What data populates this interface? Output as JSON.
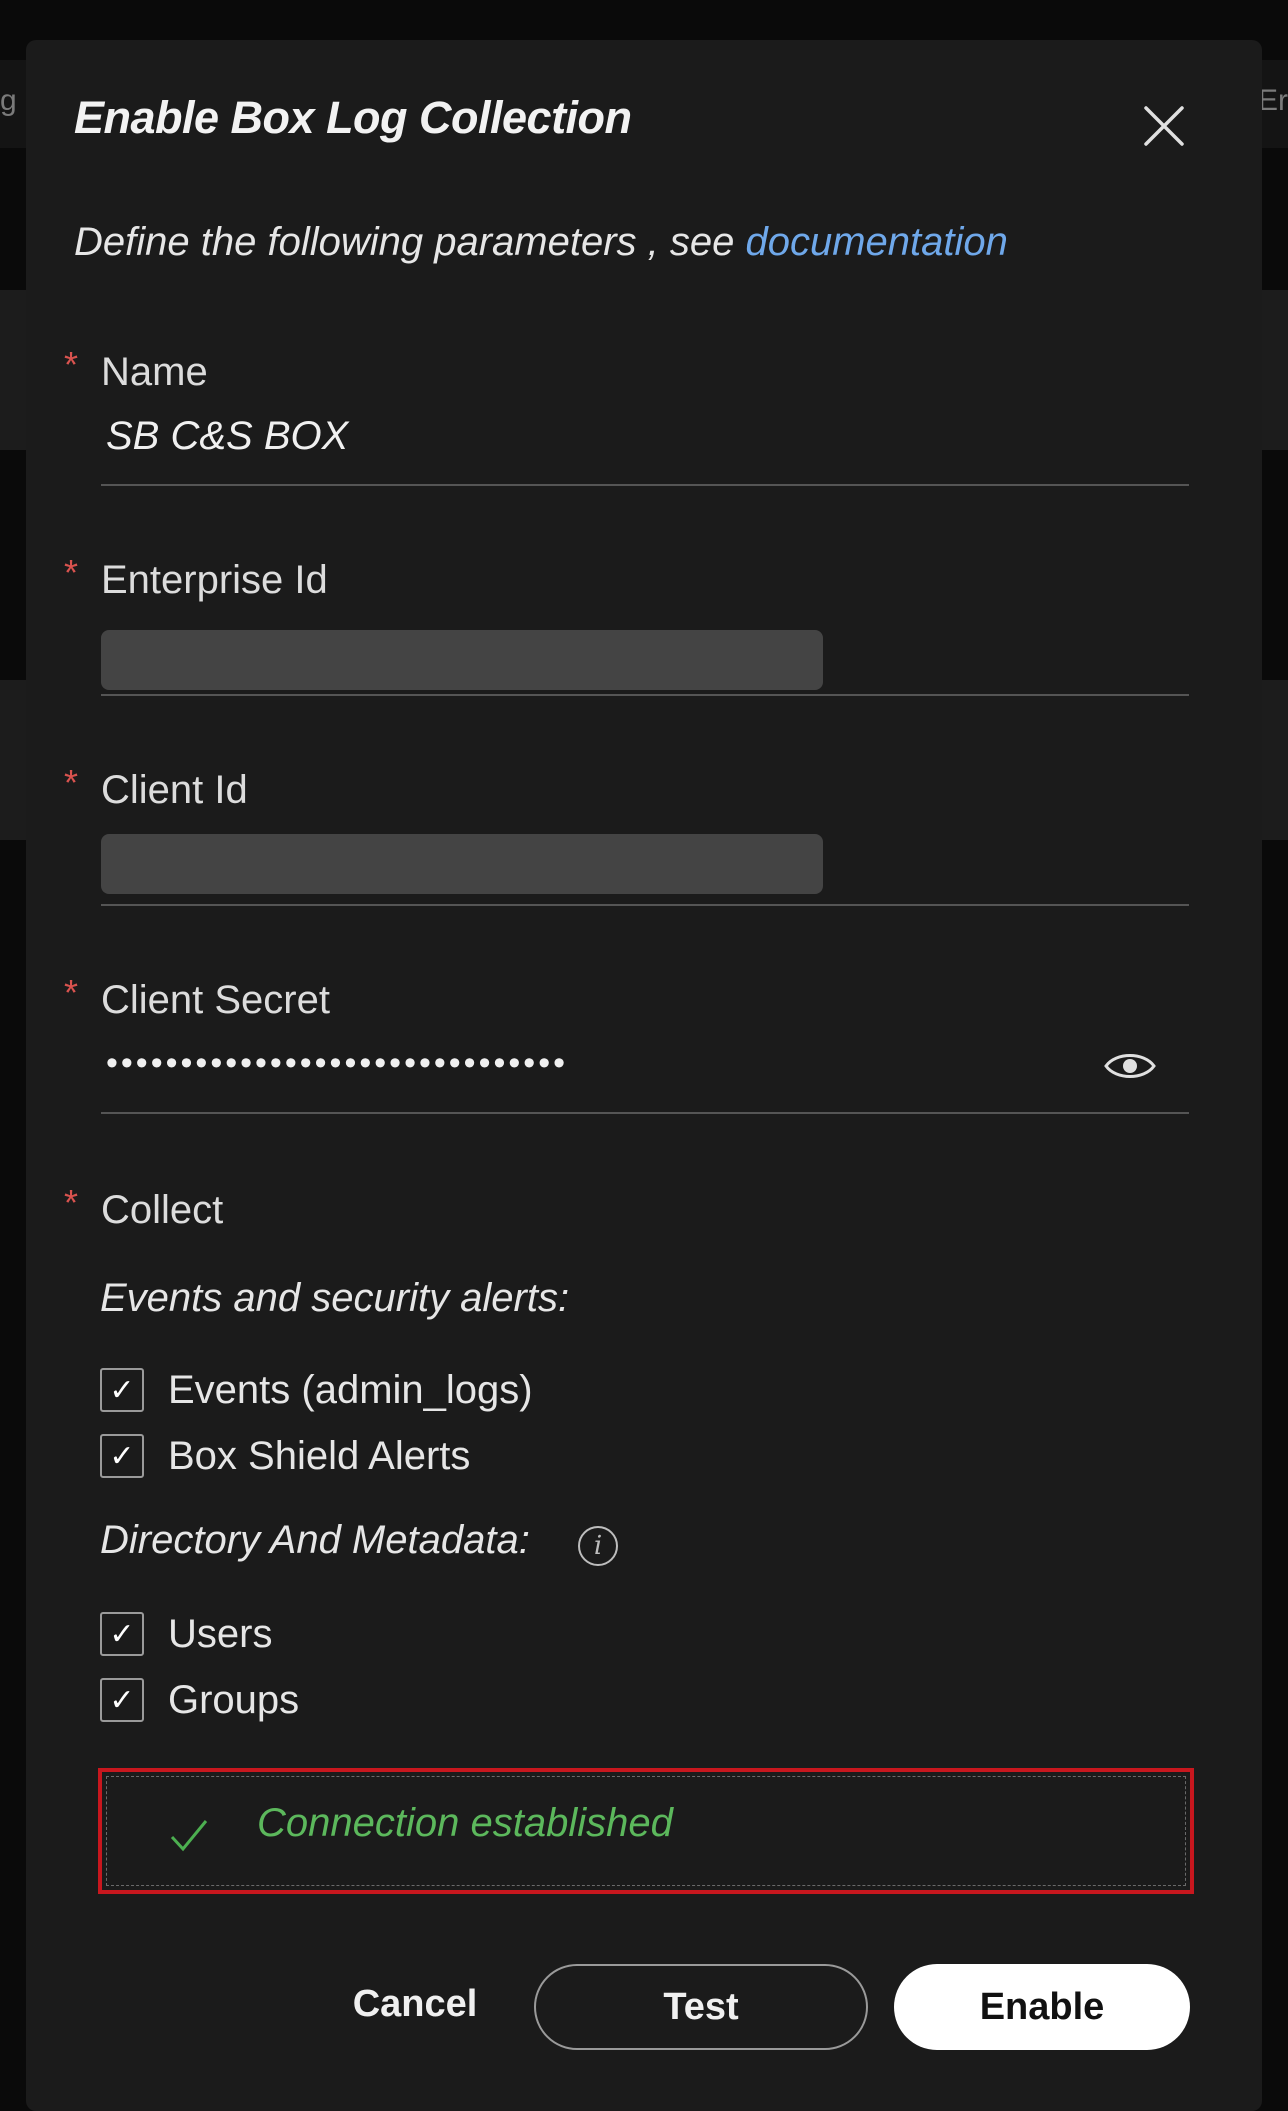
{
  "dialog": {
    "title": "Enable Box Log Collection",
    "subtitle_prefix": "Define the following parameters , see ",
    "documentation_link": "documentation"
  },
  "fields": {
    "name": {
      "label": "Name",
      "value": "SB C&S BOX"
    },
    "enterprise_id": {
      "label": "Enterprise Id"
    },
    "client_id": {
      "label": "Client Id"
    },
    "client_secret": {
      "label": "Client Secret",
      "value": "•••••••••••••••••••••••••••••••"
    },
    "required_mark": "*"
  },
  "collect": {
    "label": "Collect",
    "events_section": "Events and security alerts:",
    "events_options": [
      {
        "label": "Events (admin_logs)",
        "checked": true
      },
      {
        "label": "Box Shield Alerts",
        "checked": true
      }
    ],
    "directory_section": "Directory And Metadata:",
    "directory_options": [
      {
        "label": "Users",
        "checked": true
      },
      {
        "label": "Groups",
        "checked": true
      }
    ],
    "check_glyph": "✓"
  },
  "status": {
    "message": "Connection established",
    "icon": "check-icon",
    "color": "#5cb85c"
  },
  "buttons": {
    "cancel": "Cancel",
    "test": "Test",
    "enable": "Enable"
  },
  "background": {
    "left_fragment": "g",
    "right_fragment": "Er"
  },
  "colors": {
    "required": "#d9534f",
    "link": "#6fa8ea",
    "highlight_border": "#c8171e"
  }
}
